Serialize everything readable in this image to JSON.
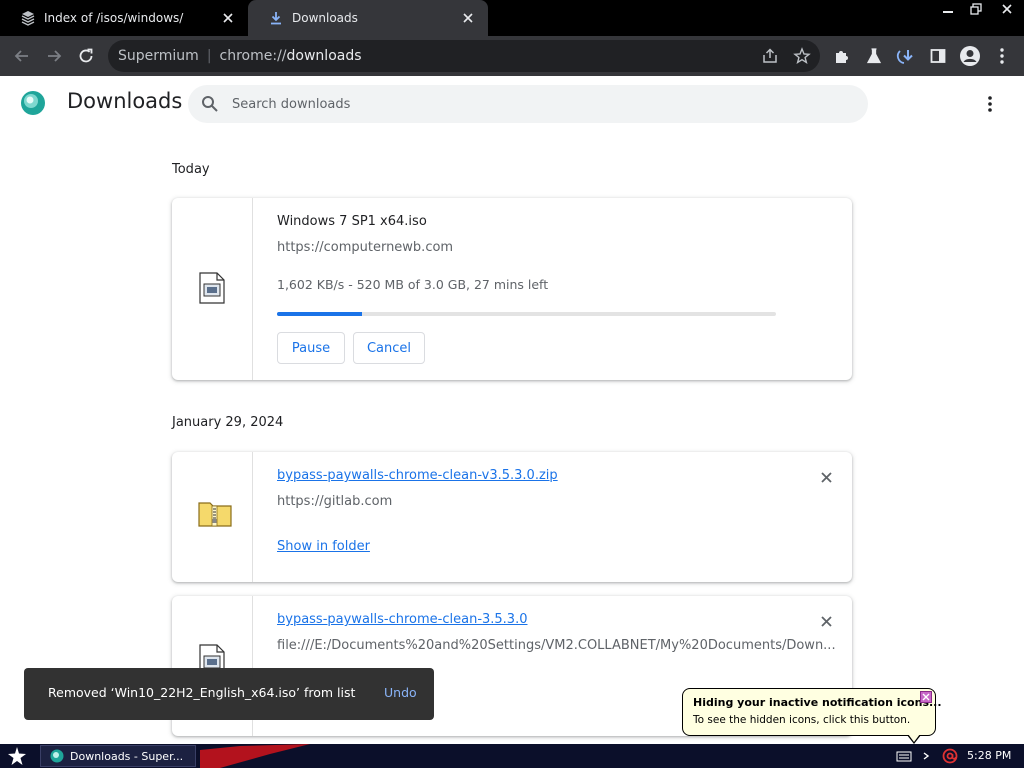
{
  "tabs": [
    {
      "title": "Index of /isos/windows/",
      "active": false,
      "favicon": "site-favicon-icon"
    },
    {
      "title": "Downloads",
      "active": true,
      "favicon": "download-icon"
    }
  ],
  "window_controls": [
    "minimize-icon",
    "restore-icon",
    "close-icon"
  ],
  "toolbar": {
    "omnibox": {
      "brand": "Supermium",
      "separator": "|",
      "scheme": "chrome://",
      "path": "downloads"
    }
  },
  "page": {
    "title": "Downloads",
    "search_placeholder": "Search downloads"
  },
  "sections": [
    {
      "date": "Today",
      "items": [
        {
          "filename": "Windows 7 SP1 x64.iso",
          "source": "https://computernewb.com",
          "status": "1,602 KB/s - 520 MB of 3.0 GB, 27 mins left",
          "progress": 0.17,
          "buttons": [
            "Pause",
            "Cancel"
          ],
          "icon": "iso-file-icon"
        }
      ]
    },
    {
      "date": "January 29, 2024",
      "items": [
        {
          "filename": "bypass-paywalls-chrome-clean-v3.5.3.0.zip",
          "source": "https://gitlab.com",
          "action": "Show in folder",
          "icon": "zip-folder-icon"
        },
        {
          "filename": "bypass-paywalls-chrome-clean-3.5.3.0",
          "source": "file:///E:/Documents%20and%20Settings/VM2.COLLABNET/My%20Documents/Down...",
          "icon": "file-icon"
        }
      ]
    }
  ],
  "toast": {
    "message": "Removed ‘Win10_22H2_English_x64.iso’ from list",
    "action": "Undo"
  },
  "balloon": {
    "title": "Hiding your inactive notification icons...",
    "body": "To see the hidden icons, click this button."
  },
  "taskbar": {
    "task_label": "Downloads - Super...",
    "clock": "5:28 PM"
  },
  "colors": {
    "accent": "#1a73e8",
    "toolbar": "#35363a",
    "tabstrip": "#000000",
    "toast_bg": "#323232",
    "toast_action": "#8ab4f8",
    "balloon_bg": "#ffffe1",
    "taskbar": "#0b0f2a"
  }
}
